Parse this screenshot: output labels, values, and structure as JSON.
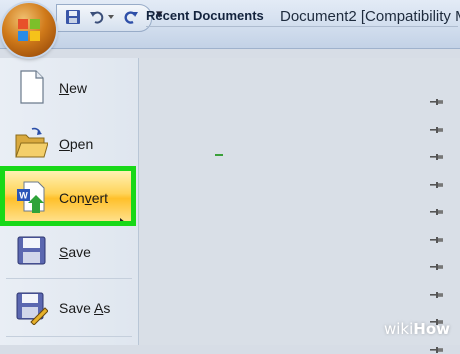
{
  "window": {
    "title": "Document2 [Compatibility M"
  },
  "quick_access": {
    "items": [
      "save-icon",
      "undo-icon",
      "dropdown-icon",
      "redo-icon"
    ],
    "more": "▾"
  },
  "menu": {
    "items": [
      {
        "label": "New",
        "icon": "new-document-icon"
      },
      {
        "label": "Open",
        "icon": "open-folder-icon"
      },
      {
        "label": "Convert",
        "icon": "convert-document-icon"
      },
      {
        "label": "Save",
        "icon": "save-icon"
      },
      {
        "label": "Save As",
        "icon": "save-as-icon"
      }
    ],
    "highlight_color": "#18d818"
  },
  "recent": {
    "header": "Recent Documents",
    "pin_icon": "pin-icon",
    "pin_count": 10
  },
  "watermark": {
    "prefix": "wiki",
    "suffix": "How"
  }
}
